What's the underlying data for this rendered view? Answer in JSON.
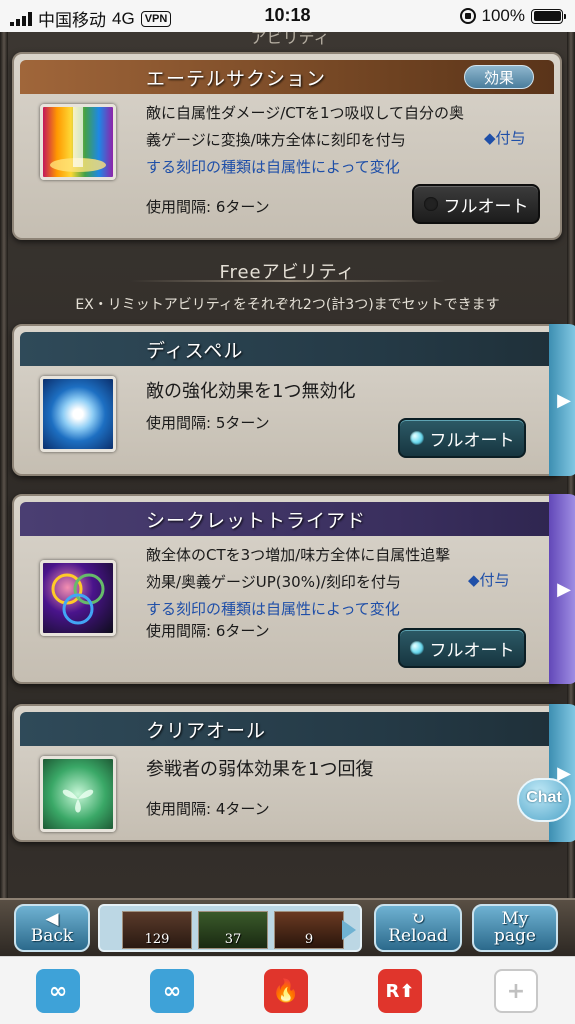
{
  "status": {
    "carrier": "中国移动",
    "network": "4G",
    "vpn": "VPN",
    "time": "10:18",
    "battery": "100%"
  },
  "header_partial": "アビリティ",
  "cards": [
    {
      "name": "エーテルサクション",
      "badge": "効果",
      "desc1": "敵に自属性ダメージ/CTを1つ吸収して自分の奥",
      "desc2": "義ゲージに変換/味方全体に刻印を付与",
      "note": "◆付与",
      "desc3": "する刻印の種類は自属性によって変化",
      "cooldown": "使用間隔: 6ターン",
      "auto": "フルオート"
    },
    {
      "name": "ディスペル",
      "desc": "敵の強化効果を1つ無効化",
      "cooldown": "使用間隔: 5ターン",
      "auto": "フルオート"
    },
    {
      "name": "シークレットトライアド",
      "desc1": "敵全体のCTを3つ増加/味方全体に自属性追撃",
      "desc2": "効果/奥義ゲージUP(30%)/刻印を付与",
      "note": "◆付与",
      "desc3": "する刻印の種類は自属性によって変化",
      "cooldown": "使用間隔: 6ターン",
      "auto": "フルオート"
    },
    {
      "name": "クリアオール",
      "desc": "参戦者の弱体効果を1つ回復",
      "cooldown": "使用間隔: 4ターン"
    }
  ],
  "free": {
    "title": "Freeアビリティ",
    "sub": "EX・リミットアビリティをそれぞれ2つ(計3つ)までセットできます"
  },
  "chat": "Chat",
  "nav": {
    "back": "Back",
    "reload": "Reload",
    "mypage_1": "My",
    "mypage_2": "page",
    "quick_counts": [
      "129",
      "37",
      "9"
    ]
  },
  "toolbar_icons": [
    "infinity-icon",
    "infinity-icon",
    "flame-icon",
    "r-up-icon",
    "plus-icon"
  ],
  "toolbar_glyphs": [
    "∞",
    "∞",
    "🔥",
    "R⬆",
    "+"
  ]
}
